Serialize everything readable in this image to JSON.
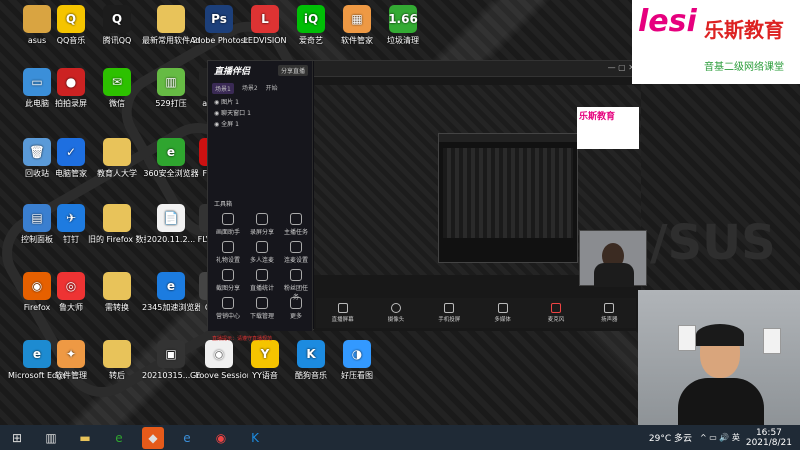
{
  "desktop": {
    "icons": [
      {
        "label": "asus",
        "color": "#d9a441",
        "glyph": ""
      },
      {
        "label": "QQ音乐",
        "color": "#f5c400",
        "glyph": "Q"
      },
      {
        "label": "腾讯QQ",
        "color": "#1c1c1c",
        "glyph": "Q"
      },
      {
        "label": "最新常用软件 20200804",
        "color": "#e8c35a",
        "glyph": ""
      },
      {
        "label": "Adobe Photoshop",
        "color": "#1c3f7a",
        "glyph": "Ps"
      },
      {
        "label": "LEDVISION",
        "color": "#d33",
        "glyph": "L"
      },
      {
        "label": "爱奇艺",
        "color": "#00be06",
        "glyph": "iQ"
      },
      {
        "label": "软件管家",
        "color": "#e94",
        "glyph": "▦"
      },
      {
        "label": "垃圾清理",
        "color": "#3a3",
        "glyph": "1.66"
      },
      {
        "label": "此电脑",
        "color": "#3b8fd9",
        "glyph": "▭"
      },
      {
        "label": "拍拍录屏",
        "color": "#c22",
        "glyph": "●"
      },
      {
        "label": "微信",
        "color": "#2dc100",
        "glyph": "✉"
      },
      {
        "label": "529打压",
        "color": "#6b4",
        "glyph": "▥"
      },
      {
        "label": "apow",
        "color": "#222",
        "glyph": ""
      },
      {
        "label": "回收站",
        "color": "#5a9ad8",
        "glyph": "🗑"
      },
      {
        "label": "电脑管家",
        "color": "#1e6fe0",
        "glyph": "✓"
      },
      {
        "label": "教育人大学",
        "color": "#e8c35a",
        "glyph": ""
      },
      {
        "label": "360安全浏览器",
        "color": "#2fa52f",
        "glyph": "e"
      },
      {
        "label": "Flash",
        "color": "#c11",
        "glyph": "F"
      },
      {
        "label": "控制面板",
        "color": "#3a7fd0",
        "glyph": "▤"
      },
      {
        "label": "钉钉",
        "color": "#1e7be0",
        "glyph": "✈"
      },
      {
        "label": "旧的 Firefox 数据",
        "color": "#e8c35a",
        "glyph": ""
      },
      {
        "label": "2020.11.2...",
        "color": "#f2f2f2",
        "glyph": "📄"
      },
      {
        "label": "FLV Enc",
        "color": "#333",
        "glyph": ""
      },
      {
        "label": "Firefox",
        "color": "#e66000",
        "glyph": "◉"
      },
      {
        "label": "鲁大师",
        "color": "#e33",
        "glyph": "◎"
      },
      {
        "label": "需转换",
        "color": "#e8c35a",
        "glyph": ""
      },
      {
        "label": "2345加速浏览器",
        "color": "#1c7ce0",
        "glyph": "e"
      },
      {
        "label": "Gho",
        "color": "#444",
        "glyph": ""
      },
      {
        "label": "Microsoft Edge",
        "color": "#1d8bd1",
        "glyph": "e"
      },
      {
        "label": "软件管理",
        "color": "#e94",
        "glyph": "✦"
      },
      {
        "label": "转后",
        "color": "#e8c35a",
        "glyph": ""
      },
      {
        "label": "20210315... .Edit",
        "color": "#333",
        "glyph": "▣"
      },
      {
        "label": "Groove Session DE...",
        "color": "#f0f0f0",
        "glyph": "◉"
      },
      {
        "label": "YY语音",
        "color": "#f5c400",
        "glyph": "Y"
      },
      {
        "label": "酷狗音乐",
        "color": "#1c8be0",
        "glyph": "K"
      },
      {
        "label": "好压看图",
        "color": "#39f",
        "glyph": "◑"
      }
    ]
  },
  "app_window": {
    "title": "直播伴侣",
    "tab_label": "分享直播",
    "scene_tabs": [
      "场景1",
      "场景2",
      "开始"
    ],
    "scenes": [
      "图片 1",
      "聊天窗口 1",
      "全屏 1"
    ],
    "tools_label": "工具箱",
    "tool_buttons": [
      "画面助手",
      "录屏分享",
      "主播任务",
      "礼物设置",
      "多人连麦",
      "连麦设置",
      "截图分享",
      "直播统计",
      "粉丝团任务",
      "营销中心",
      "下载管理",
      "更多"
    ],
    "bottom_controls": [
      "直播屏幕",
      "摄像头",
      "手机投屏",
      "多媒体",
      "麦克风",
      "扬声器"
    ],
    "notice": "直播提示：请遵守直播规范"
  },
  "brand": {
    "logo_text": "乐斯教育",
    "logo_sub": "音基二级网络课堂",
    "accent_color": "#e6007e"
  },
  "taskbar": {
    "weather": "29°C 多云",
    "time": "16:57",
    "date": "2021/8/21"
  }
}
